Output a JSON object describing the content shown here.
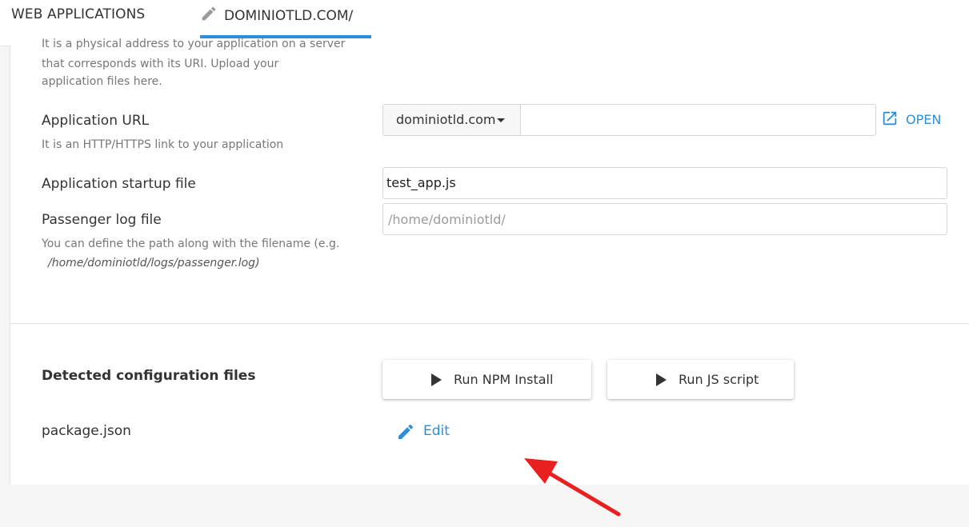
{
  "tabs": {
    "web_applications": "WEB APPLICATIONS",
    "domain": "DOMINIOTLD.COM/"
  },
  "app_root": {
    "help_lines": [
      "It is a physical address to your application on a server",
      "that corresponds with its URI. Upload your",
      "application files here."
    ]
  },
  "app_url": {
    "label": "Application URL",
    "help": "It is an HTTP/HTTPS link to your application",
    "domain_select": "dominiotld.com",
    "path_value": "",
    "open_label": "OPEN"
  },
  "startup_file": {
    "label": "Application startup file",
    "value": "test_app.js"
  },
  "passenger_log": {
    "label": "Passenger log file",
    "placeholder": "/home/dominiotld/",
    "help": "You can define the path along with the filename (e.g.",
    "help_example": "/home/dominiotld/logs/passenger.log)"
  },
  "config": {
    "label": "Detected configuration files",
    "run_npm_label": "Run NPM Install",
    "run_js_label": "Run JS script",
    "file_name": "package.json",
    "edit_label": "Edit"
  },
  "colors": {
    "accent": "#2e8fd8",
    "annotation_arrow": "#e8201f"
  },
  "icons": {
    "tab_icon": "pencil-icon",
    "open_icon": "external-link-icon",
    "button_icon": "play-icon",
    "edit_icon": "pencil-icon"
  }
}
